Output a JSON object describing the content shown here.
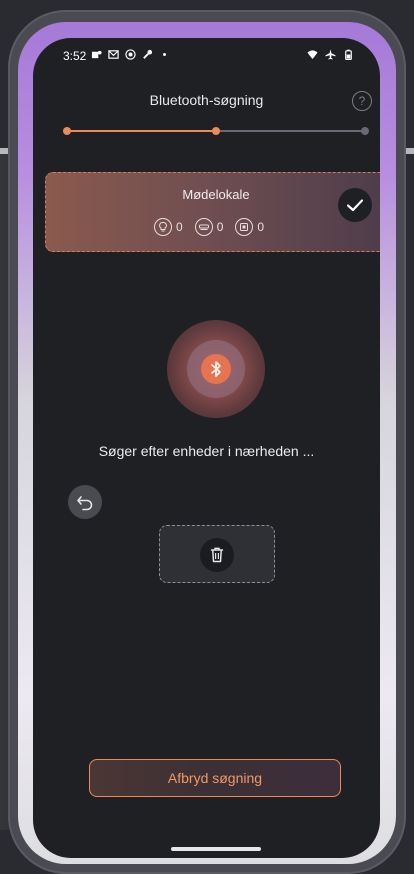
{
  "status_bar": {
    "time": "3:52",
    "left_icons": [
      "teams-icon",
      "outlook-icon",
      "record-icon",
      "wrench-icon",
      "dot-icon"
    ],
    "right_icons": [
      "wifi-icon",
      "airplane-icon",
      "battery-icon"
    ]
  },
  "header": {
    "title": "Bluetooth-søgning",
    "help_icon": "help-icon",
    "help_label": "?"
  },
  "progress": {
    "steps": 3,
    "current_step": 2,
    "active_color": "#f08a52",
    "inactive_color": "#6a6976"
  },
  "room": {
    "name": "Mødelokale",
    "stats": [
      {
        "icon": "bulb-icon",
        "count": "0"
      },
      {
        "icon": "ceiling-light-icon",
        "count": "0"
      },
      {
        "icon": "panel-icon",
        "count": "0"
      }
    ],
    "selected": true
  },
  "scan": {
    "icon": "bluetooth-icon",
    "status_text": "Søger efter enheder i nærheden ..."
  },
  "actions": {
    "undo_icon": "undo-icon",
    "trash_icon": "trash-icon",
    "abort_label": "Afbryd søgning"
  },
  "colors": {
    "accent": "#f08a52",
    "background": "#1f2024"
  }
}
